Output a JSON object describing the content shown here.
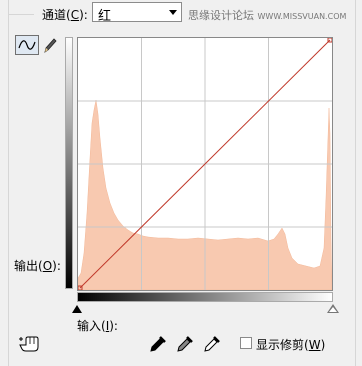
{
  "channel": {
    "label_main": "通道(",
    "label_key": "C",
    "label_end": "):",
    "selected": "红"
  },
  "watermark": {
    "cn": "思缘设计论坛",
    "en": "WWW.MISSVUAN.COM"
  },
  "tools": {
    "curve_icon": "curve-icon",
    "pencil_icon": "pencil-icon"
  },
  "output": {
    "label_main": "输出(",
    "label_key": "O",
    "label_end": "):"
  },
  "input": {
    "label_main": "输入(",
    "label_key": "I",
    "label_end": "):"
  },
  "show_clipping": {
    "label_main": "显示修剪(",
    "label_key": "W",
    "label_end": ")",
    "checked": false
  },
  "colors": {
    "histogram": "#f8c9b0",
    "curve": "#c0392b",
    "grid": "#c8c8c8"
  }
}
